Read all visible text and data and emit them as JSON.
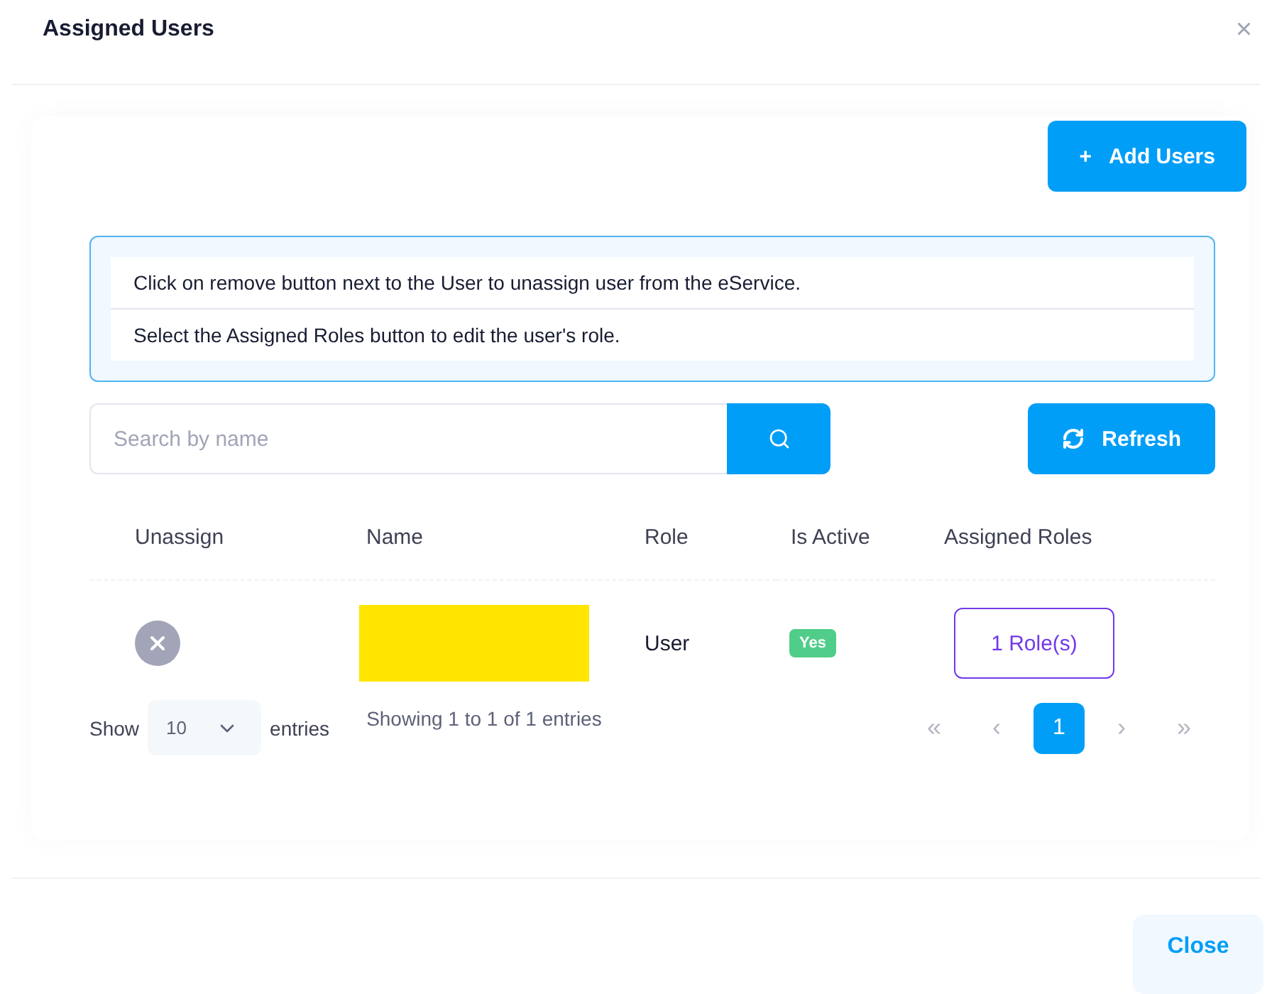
{
  "dialog": {
    "title": "Assigned Users",
    "close_icon": "×"
  },
  "add_button": {
    "icon": "+",
    "label": "Add Users"
  },
  "info_lines": [
    "Click on remove button next to the User to unassign user from the eService.",
    "Select the Assigned Roles button to edit the user's role."
  ],
  "search": {
    "placeholder": "Search by name"
  },
  "refresh_button": {
    "label": "Refresh"
  },
  "table": {
    "columns": [
      "Unassign",
      "Name",
      "Role",
      "Is Active",
      "Assigned Roles"
    ],
    "rows": [
      {
        "name_redacted": true,
        "role": "User",
        "active": true,
        "active_label": "Yes",
        "roles_button": "1 Role(s)"
      }
    ]
  },
  "footer": {
    "show_label": "Show",
    "page_size": "10",
    "entries_label": "entries",
    "summary": "Showing 1 to 1 of 1 entries",
    "pages": [
      {
        "label": "«",
        "selected": false
      },
      {
        "label": "‹",
        "selected": false
      },
      {
        "label": "1",
        "selected": true
      },
      {
        "label": "›",
        "selected": false
      },
      {
        "label": "»",
        "selected": false
      }
    ]
  },
  "close_button": "Close"
}
